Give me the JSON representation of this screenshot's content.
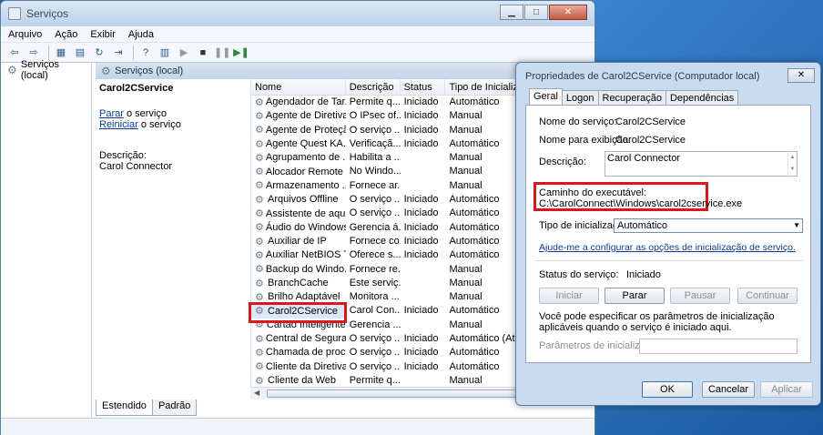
{
  "main": {
    "title": "Serviços",
    "menu": [
      "Arquivo",
      "Ação",
      "Exibir",
      "Ajuda"
    ],
    "tree_item": "Serviços (local)",
    "panel_header": "Serviços (local)",
    "selected_service": "Carol2CService",
    "action_stop": "Parar",
    "action_stop_suffix": " o serviço",
    "action_restart": "Reiniciar",
    "action_restart_suffix": " o serviço",
    "desc_label": "Descrição:",
    "desc_value": "Carol Connector",
    "columns": [
      "Nome",
      "Descrição",
      "Status",
      "Tipo de Inicializa"
    ],
    "rows": [
      [
        "Agendador de Tar...",
        "Permite q...",
        "Iniciado",
        "Automático"
      ],
      [
        "Agente de Diretiva...",
        "O IPsec of...",
        "Iniciado",
        "Manual"
      ],
      [
        "Agente de Proteçã...",
        "O serviço ...",
        "Iniciado",
        "Manual"
      ],
      [
        "Agente Quest KA...",
        "Verificaçã...",
        "Iniciado",
        "Automático"
      ],
      [
        "Agrupamento de ...",
        "Habilita a ...",
        "",
        "Manual"
      ],
      [
        "Alocador Remote ...",
        "No Windo...",
        "",
        "Manual"
      ],
      [
        "Armazenamento ...",
        "Fornece ar...",
        "",
        "Manual"
      ],
      [
        "Arquivos Offline",
        "O serviço ...",
        "Iniciado",
        "Automático"
      ],
      [
        "Assistente de aqui...",
        "O serviço ...",
        "Iniciado",
        "Automático"
      ],
      [
        "Áudio do Windows",
        "Gerencia á...",
        "Iniciado",
        "Automático"
      ],
      [
        "Auxiliar de IP",
        "Fornece co...",
        "Iniciado",
        "Automático"
      ],
      [
        "Auxiliar NetBIOS T...",
        "Oferece s...",
        "Iniciado",
        "Automático"
      ],
      [
        "Backup do Windo...",
        "Fornece re...",
        "",
        "Manual"
      ],
      [
        "BranchCache",
        "Este serviç...",
        "",
        "Manual"
      ],
      [
        "Brilho Adaptável",
        "Monitora ...",
        "",
        "Manual"
      ],
      [
        "Carol2CService",
        "Carol Con...",
        "Iniciado",
        "Automático"
      ],
      [
        "Cartão Inteligente",
        "Gerencia ...",
        "",
        "Manual"
      ],
      [
        "Central de Segura...",
        "O serviço ...",
        "Iniciado",
        "Automático (Atra"
      ],
      [
        "Chamada de proc...",
        "O serviço ...",
        "Iniciado",
        "Automático"
      ],
      [
        "Cliente da Diretiva...",
        "O serviço ...",
        "Iniciado",
        "Automático"
      ],
      [
        "Cliente da Web",
        "Permite q...",
        "",
        "Manual"
      ]
    ],
    "tab_extended": "Estendido",
    "tab_standard": "Padrão"
  },
  "dialog": {
    "title": "Propriedades de Carol2CService (Computador local)",
    "tabs": [
      "Geral",
      "Logon",
      "Recuperação",
      "Dependências"
    ],
    "service_name_label": "Nome do serviço:",
    "service_name": "Carol2CService",
    "display_name_label": "Nome para exibição:",
    "display_name": "Carol2CService",
    "description_label": "Descrição:",
    "description": "Carol Connector",
    "exe_path_label": "Caminho do executável:",
    "exe_path": "C:\\CarolConnect\\Windows\\carol2cservice.exe",
    "startup_type_label": "Tipo de inicialização:",
    "startup_type": "Automático",
    "help_link": "Ajude-me a configurar as opções de inicialização de serviço.",
    "status_label": "Status do serviço:",
    "status_value": "Iniciado",
    "btn_start": "Iniciar",
    "btn_stop": "Parar",
    "btn_pause": "Pausar",
    "btn_continue": "Continuar",
    "params_note": "Você pode especificar os parâmetros de inicialização aplicáveis quando o serviço é iniciado aqui.",
    "params_label": "Parâmetros de inicialização:",
    "btn_ok": "OK",
    "btn_cancel": "Cancelar",
    "btn_apply": "Aplicar"
  },
  "colors": {
    "highlight_box": "#e0151c",
    "link": "#0b3b9c"
  }
}
